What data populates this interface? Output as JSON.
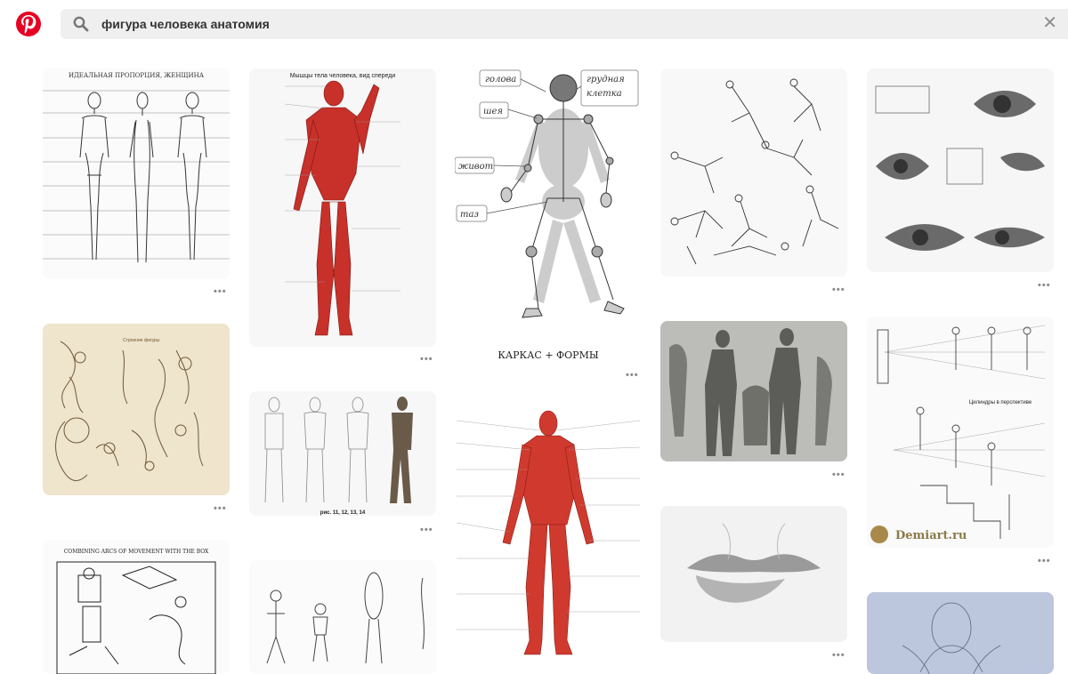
{
  "header": {
    "logo": "pinterest-logo",
    "search_query": "фигура человека анатомия",
    "clear_symbol": "✕"
  },
  "pins": {
    "p1": {
      "title": "ИДЕАЛЬНАЯ ПРОПОРЦИЯ, ЖЕНЩИНА"
    },
    "p2": {
      "title": "Мышцы тела человека, вид спереди"
    },
    "p3": {
      "labels": [
        "голова",
        "грудная",
        "клетка",
        "шея",
        "живот",
        "таз"
      ],
      "caption": "КАРКАС + ФОРМЫ"
    },
    "p4": {},
    "p5": {},
    "p6": {
      "title": "Строение фигуры"
    },
    "p7": {
      "caption": "рис. 11, 12, 13, 14"
    },
    "p8": {
      "caption": ""
    },
    "p9": {},
    "p10": {
      "title": "Цилиндры в перспективе",
      "brand": "Demiart.ru"
    },
    "p11": {
      "title": "COMBINING ARCS OF MOVEMENT WITH THE BOX"
    },
    "p12": {},
    "p13": {},
    "p14": {},
    "p15": {}
  },
  "more_label": "•••",
  "colors": {
    "brand_red": "#e60023",
    "muscle_red": "#c8302a"
  }
}
